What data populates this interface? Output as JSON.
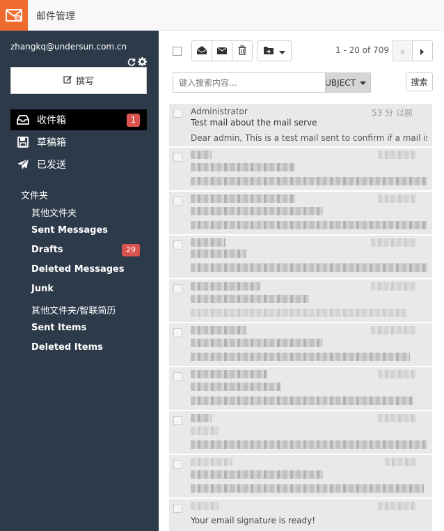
{
  "app": {
    "title": "邮件管理",
    "logo_icon": "mail-at-icon",
    "brand_color": "#ef6b2d"
  },
  "sidebar": {
    "account": "zhangkq@undersun.com.cn",
    "compose_label": "撰写",
    "nav": [
      {
        "label": "收件箱",
        "icon": "inbox-icon",
        "badge": "1",
        "active": true
      },
      {
        "label": "草稿箱",
        "icon": "save-icon"
      },
      {
        "label": "已发送",
        "icon": "paper-plane-icon"
      }
    ],
    "folders_heading": "文件夹",
    "folders": [
      {
        "label": "其他文件夹"
      },
      {
        "label": "Sent Messages"
      },
      {
        "label": "Drafts",
        "badge": "29"
      },
      {
        "label": "Deleted Messages"
      },
      {
        "label": "Junk"
      },
      {
        "label": "其他文件夹/智联简历"
      },
      {
        "label": "Sent Items"
      },
      {
        "label": "Deleted Items"
      }
    ]
  },
  "toolbar": {
    "pager": "1 - 20 of 709"
  },
  "search": {
    "placeholder": "键入搜索内容...",
    "field": "SUBJECT",
    "button": "搜索"
  },
  "messages": [
    {
      "from": "Administrator",
      "time": "53 分 以前",
      "subject": "Test mail about the mail serve",
      "snippet": "Dear admin, This is a test mail sent to confirm if a mail is"
    }
  ],
  "signature_text": "Your email signature is ready!"
}
